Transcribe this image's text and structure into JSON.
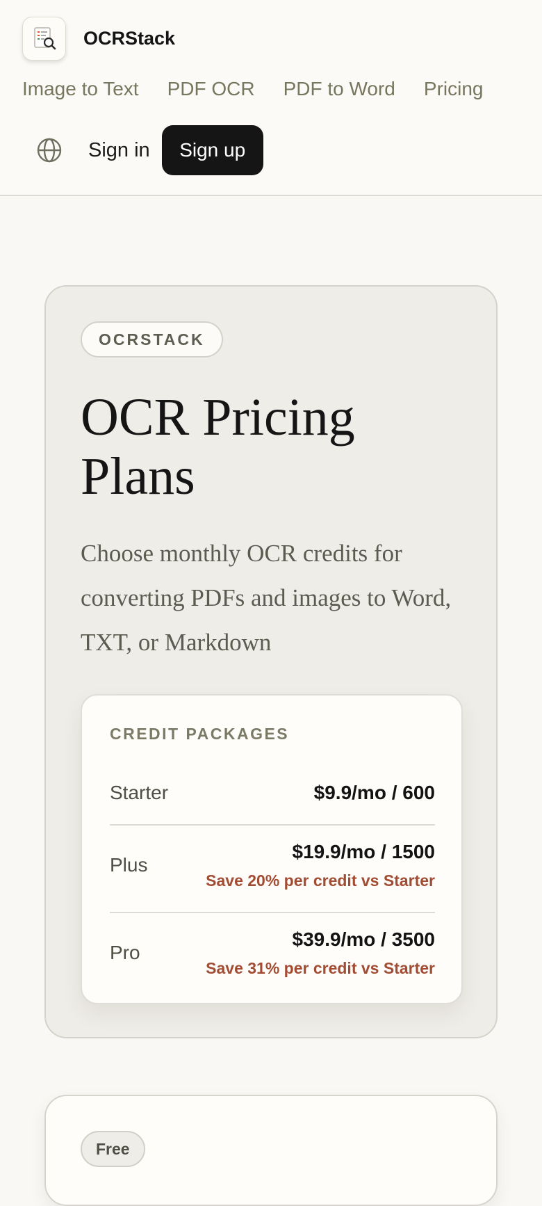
{
  "header": {
    "brand_name": "OCRStack",
    "logo_icon": "document-scan-icon",
    "nav": [
      "Image to Text",
      "PDF OCR",
      "PDF to Word",
      "Pricing"
    ],
    "language_icon": "globe-icon",
    "sign_in": "Sign in",
    "sign_up": "Sign up"
  },
  "hero": {
    "eyebrow": "OCRSTACK",
    "title": "OCR Pricing Plans",
    "subtitle": "Choose monthly OCR credits for converting PDFs and images to Word, TXT, or Markdown",
    "packages": {
      "label": "CREDIT PACKAGES",
      "rows": [
        {
          "name": "Starter",
          "price": "$9.9/mo / 600",
          "note": ""
        },
        {
          "name": "Plus",
          "price": "$19.9/mo / 1500",
          "note": "Save 20% per credit vs Starter"
        },
        {
          "name": "Pro",
          "price": "$39.9/mo / 3500",
          "note": "Save 31% per credit vs Starter"
        }
      ]
    }
  },
  "plans": {
    "free_badge": "Free"
  },
  "colors": {
    "accent_dark": "#151515",
    "save_text": "#a24c33",
    "nav_text": "#77775f",
    "hero_bg": "#efede8"
  }
}
